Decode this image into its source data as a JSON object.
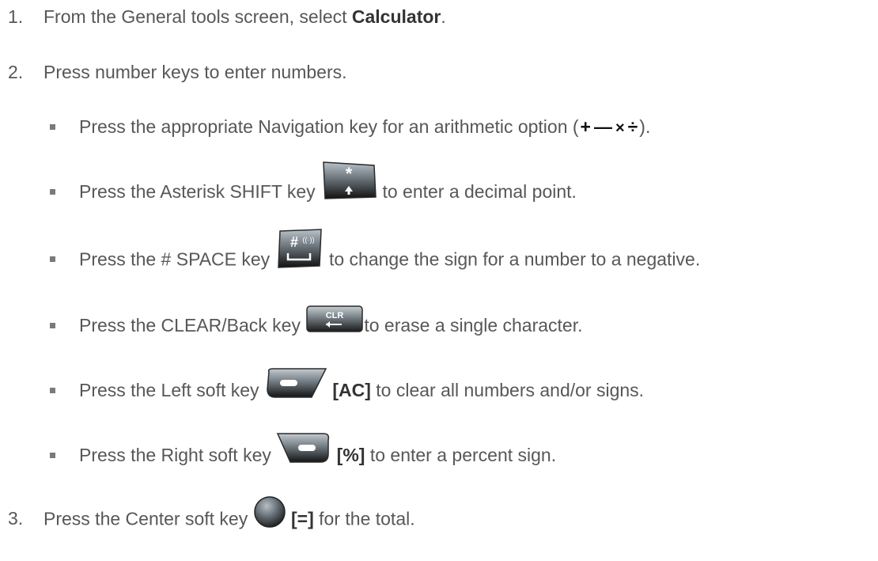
{
  "steps": [
    {
      "number": "1.",
      "pre": "From the General tools screen, select ",
      "bold": "Calculator",
      "post": "."
    },
    {
      "number": "2.",
      "text": "Press number keys to enter numbers."
    },
    {
      "number": "3.",
      "pre": "Press the Center soft key ",
      "bold": "[=]",
      "post": " for the total."
    }
  ],
  "bullets": [
    {
      "pre": "Press the appropriate Navigation key for an arithmetic option (",
      "ops": [
        "+",
        "—",
        "×",
        "÷"
      ],
      "post": ")."
    },
    {
      "pre": "Press the Asterisk SHIFT key ",
      "post": " to enter a decimal point.",
      "key_label": "*"
    },
    {
      "pre": "Press the # SPACE key ",
      "post": " to change the sign for a number to a negative.",
      "key_label": "#"
    },
    {
      "pre": "Press the CLEAR/Back key ",
      "post": "to erase a single character.",
      "key_label": "CLR"
    },
    {
      "pre": "Press the Left soft key ",
      "bold": "[AC]",
      "post": " to clear all numbers and/or signs."
    },
    {
      "pre": "Press the Right soft key ",
      "bold": "[%]",
      "post": " to enter a percent sign."
    }
  ],
  "icons": {
    "asterisk_key": "asterisk-shift-key-icon",
    "hash_key": "hash-space-key-icon",
    "clear_key": "clear-back-key-icon",
    "left_soft": "left-soft-key-icon",
    "right_soft": "right-soft-key-icon",
    "center_soft": "center-soft-key-icon"
  }
}
